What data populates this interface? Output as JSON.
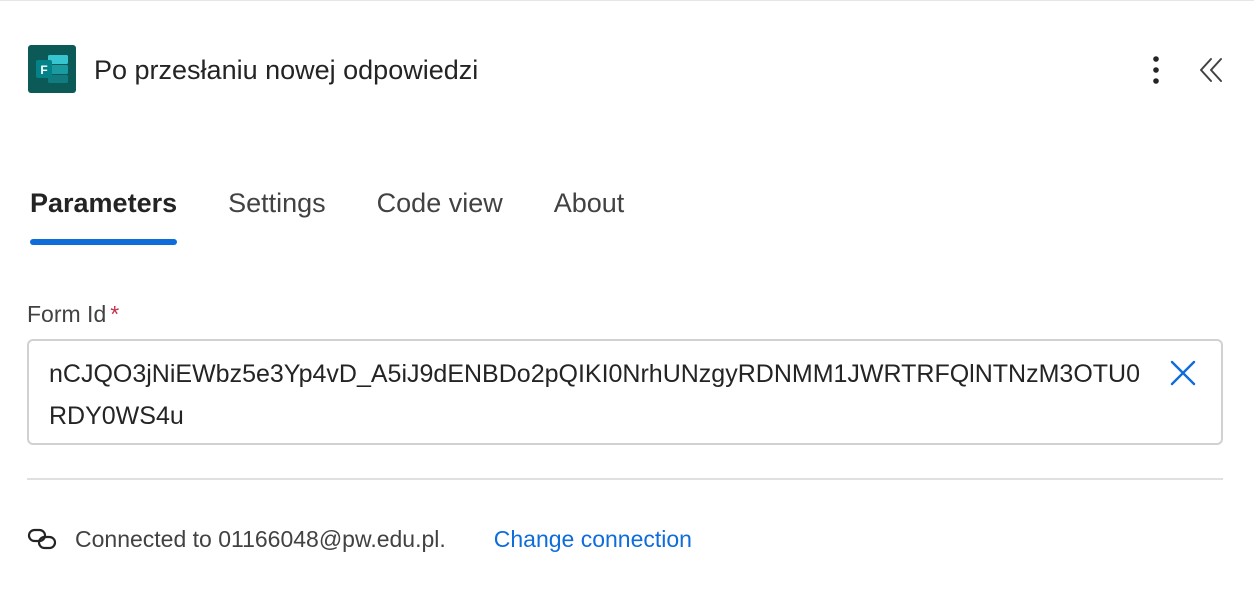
{
  "header": {
    "title": "Po przesłaniu nowej odpowiedzi",
    "app_icon": "microsoft-forms-icon",
    "app_icon_letter": "F",
    "more_icon": "more-vertical-icon",
    "collapse_icon": "double-chevron-left-icon"
  },
  "tabs": [
    {
      "label": "Parameters",
      "active": true
    },
    {
      "label": "Settings",
      "active": false
    },
    {
      "label": "Code view",
      "active": false
    },
    {
      "label": "About",
      "active": false
    }
  ],
  "form_id": {
    "label": "Form Id",
    "required_marker": "*",
    "value": "nCJQO3jNiEWbz5e3Yp4vD_A5iJ9dENBDo2pQIKI0NrhUNzgyRDNMM1JWRTRFQlNTNzM3OTU0RDY0WS4u",
    "clear_icon": "close-icon"
  },
  "connection": {
    "icon": "link-icon",
    "text": "Connected to 01166048@pw.edu.pl.",
    "change_label": "Change connection"
  },
  "colors": {
    "accent": "#0f6cdb",
    "forms_brand": "#0b5a58",
    "required": "#c4314b"
  }
}
